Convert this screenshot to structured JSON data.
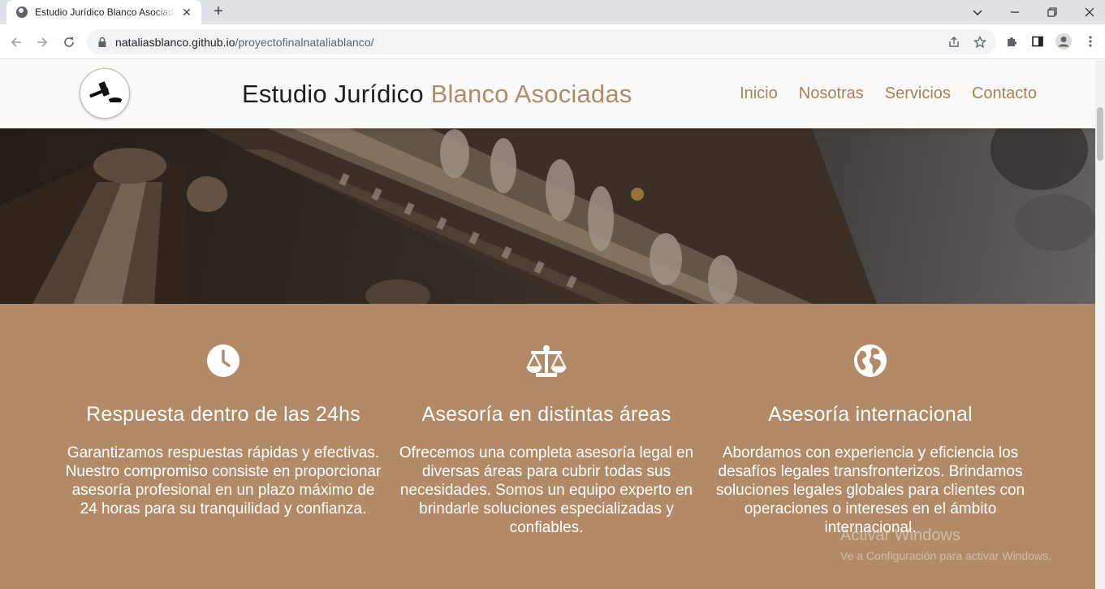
{
  "browser": {
    "tab_title": "Estudio Jurídico Blanco Asociadas",
    "url_host": "nataliasblanco.github.io",
    "url_path": "/proyectofinalnataliablanco/"
  },
  "site": {
    "brand_part1": "Estudio Jurídico",
    "brand_part2": "Blanco Asociadas",
    "nav": [
      "Inicio",
      "Nosotras",
      "Servicios",
      "Contacto"
    ]
  },
  "features": [
    {
      "icon": "clock-icon",
      "title": "Respuesta dentro de las 24hs",
      "text": "Garantizamos respuestas rápidas y efectivas. Nuestro compromiso consiste en proporcionar asesoría profesional en un plazo máximo de 24 horas para su tranquilidad y confianza."
    },
    {
      "icon": "scale-icon",
      "title": "Asesoría en distintas áreas",
      "text": "Ofrecemos una completa asesoría legal en diversas áreas para cubrir todas sus necesidades. Somos un equipo experto en brindarle soluciones especializadas y confiables."
    },
    {
      "icon": "globe-icon",
      "title": "Asesoría internacional",
      "text": "Abordamos con experiencia y eficiencia los desafíos legales transfronterizos. Brindamos soluciones legales globales para clientes con operaciones o intereses en el ámbito internacional."
    }
  ],
  "watermark": {
    "line1": "Activar Windows",
    "line2": "Ve a Configuración para activar Windows."
  },
  "colors": {
    "accent": "#b28a67",
    "nav_text": "#a3805e",
    "header_bg": "#fbfaf8"
  }
}
